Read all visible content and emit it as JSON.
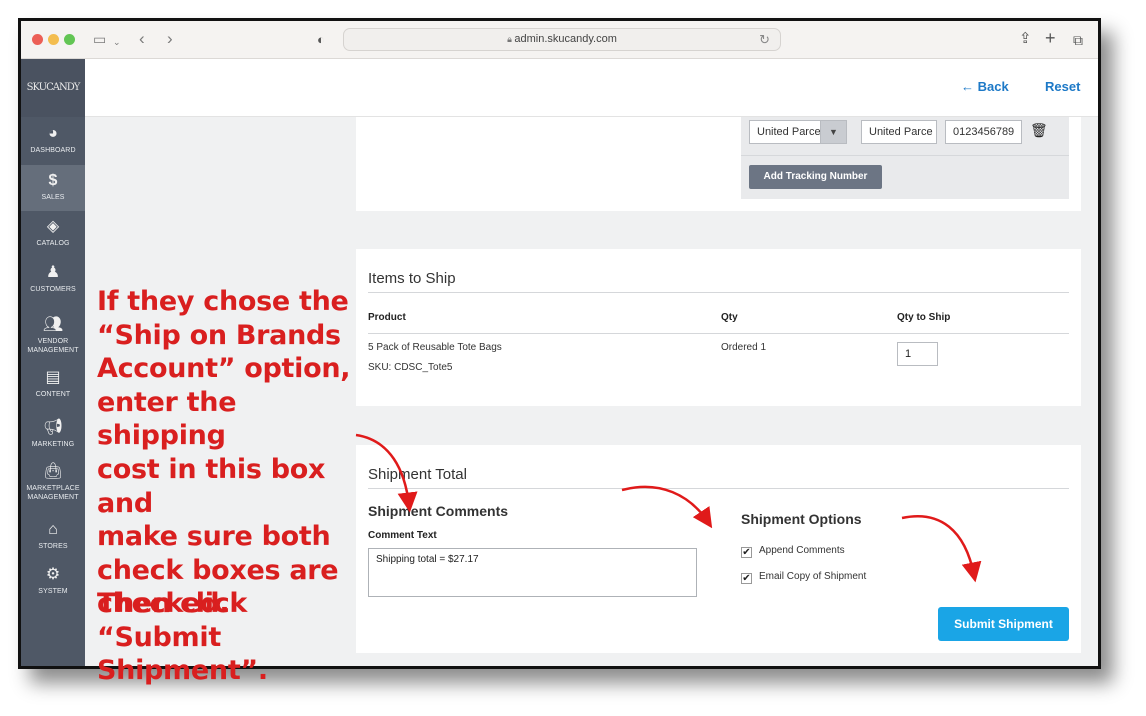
{
  "browser": {
    "url": "admin.skucandy.com",
    "icons": [
      "sidebar-toggle-icon",
      "chevron-down-icon",
      "back-arrow-icon",
      "forward-arrow-icon",
      "shield-icon",
      "lock-icon",
      "reload-icon",
      "share-icon",
      "new-tab-icon",
      "tabs-icon"
    ]
  },
  "sidebar": {
    "logo": "SKUCANDY",
    "items": [
      {
        "label": "DASHBOARD",
        "icon": "gauge-icon"
      },
      {
        "label": "SALES",
        "icon": "dollar-icon",
        "active": true
      },
      {
        "label": "CATALOG",
        "icon": "cube-icon"
      },
      {
        "label": "CUSTOMERS",
        "icon": "person-icon"
      },
      {
        "label": "VENDOR",
        "label2": "MANAGEMENT",
        "icon": "users-icon"
      },
      {
        "label": "CONTENT",
        "icon": "layout-icon"
      },
      {
        "label": "MARKETING",
        "icon": "megaphone-icon"
      },
      {
        "label": "MARKETPLACE",
        "label2": "MANAGEMENT",
        "icon": "bag-icon"
      },
      {
        "label": "STORES",
        "icon": "store-icon"
      },
      {
        "label": "SYSTEM",
        "icon": "gear-icon"
      }
    ]
  },
  "header": {
    "back_label": "← Back",
    "reset_label": "Reset"
  },
  "tracking": {
    "carrier_select": "United Parce",
    "carrier_title": "United Parce",
    "tracking_number": "0123456789",
    "add_button": "Add Tracking Number"
  },
  "items_to_ship": {
    "title": "Items to Ship",
    "columns": [
      "Product",
      "Qty",
      "Qty to Ship"
    ],
    "rows": [
      {
        "product": "5 Pack of Reusable Tote Bags",
        "sku": "SKU: CDSC_Tote5",
        "qty": "Ordered 1",
        "qty_to_ship": "1"
      }
    ]
  },
  "shipment_total": {
    "title": "Shipment Total",
    "comments_heading": "Shipment Comments",
    "comment_label": "Comment Text",
    "comment_value": "Shipping total = $27.17",
    "options_heading": "Shipment Options",
    "options": [
      {
        "label": "Append Comments",
        "checked": true
      },
      {
        "label": "Email Copy of Shipment",
        "checked": true
      }
    ],
    "submit_label": "Submit Shipment"
  },
  "annotation": {
    "lines": [
      "If they chose the",
      "“Ship on Brands",
      "Account” option,",
      "enter the shipping",
      "cost in this box and",
      "make sure both",
      "check boxes are",
      "checked."
    ],
    "lines2": [
      "Then click “Submit",
      "Shipment”."
    ],
    "color": "#d91f1f"
  },
  "colors": {
    "sidebar": "#4f5866",
    "link": "#1d79c7",
    "submit": "#1aa5e6",
    "annotation": "#d91f1f"
  }
}
